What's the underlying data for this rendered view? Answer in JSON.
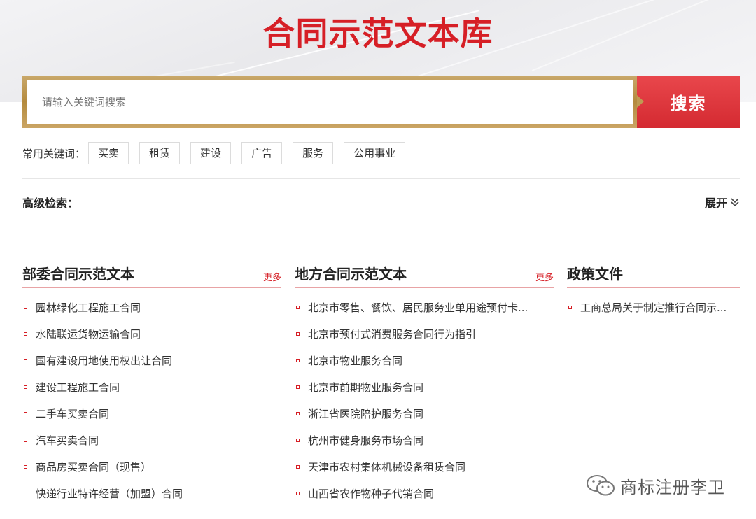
{
  "header": {
    "title": "合同示范文本库"
  },
  "search": {
    "placeholder": "请输入关键词搜索",
    "button_label": "搜索"
  },
  "keywords": {
    "label": "常用关键词：",
    "tags": [
      "买卖",
      "租赁",
      "建设",
      "广告",
      "服务",
      "公用事业"
    ]
  },
  "advanced": {
    "label": "高级检索：",
    "expand_label": "展开"
  },
  "columns": [
    {
      "title": "部委合同示范文本",
      "more": "更多",
      "items": [
        "园林绿化工程施工合同",
        "水陆联运货物运输合同",
        "国有建设用地使用权出让合同",
        "建设工程施工合同",
        "二手车买卖合同",
        "汽车买卖合同",
        "商品房买卖合同（现售）",
        "快递行业特许经营（加盟）合同"
      ]
    },
    {
      "title": "地方合同示范文本",
      "more": "更多",
      "items": [
        "北京市零售、餐饮、居民服务业单用途预付卡...",
        "北京市预付式消费服务合同行为指引",
        "北京市物业服务合同",
        "北京市前期物业服务合同",
        "浙江省医院陪护服务合同",
        "杭州市健身服务市场合同",
        "天津市农村集体机械设备租赁合同",
        "山西省农作物种子代销合同"
      ]
    },
    {
      "title": "政策文件",
      "items": [
        "工商总局关于制定推行合同示..."
      ]
    }
  ],
  "watermark": {
    "text": "商标注册李卫"
  },
  "colors": {
    "brand_red": "#d61f26",
    "gold": "#b48a3e",
    "button_red": "#e03a40"
  }
}
